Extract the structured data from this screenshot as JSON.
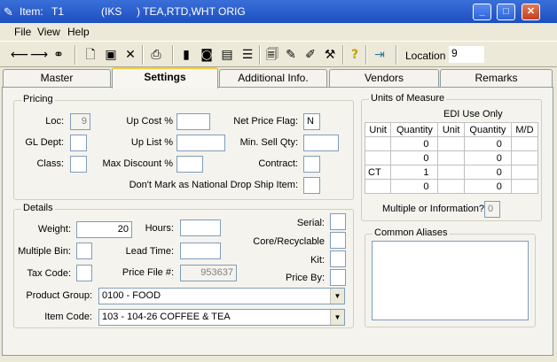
{
  "window": {
    "title_item_label": "Item:",
    "title_item_code": "T1",
    "title_item_desc": "(IKS     ) TEA,RTD,WHT ORIG",
    "minimize": "_",
    "maximize": "□",
    "close": "✕"
  },
  "menu": {
    "file": "File",
    "view": "View",
    "help": "Help"
  },
  "toolbar": {
    "location_label": "Location",
    "location_value": "9"
  },
  "tabs": [
    {
      "label": "Master"
    },
    {
      "label": "Settings"
    },
    {
      "label": "Additional Info."
    },
    {
      "label": "Vendors"
    },
    {
      "label": "Remarks"
    }
  ],
  "pricing": {
    "group_label": "Pricing",
    "loc_label": "Loc:",
    "loc_value": "9",
    "gl_dept_label": "GL Dept:",
    "gl_dept_value": "",
    "class_label": "Class:",
    "class_value": "",
    "up_cost_label": "Up Cost %",
    "up_cost_value": "",
    "up_list_label": "Up List %",
    "up_list_value": "",
    "max_discount_label": "Max Discount %",
    "max_discount_value": "",
    "net_price_flag_label": "Net Price Flag:",
    "net_price_flag_value": "N",
    "min_sell_qty_label": "Min. Sell Qty:",
    "min_sell_qty_value": "",
    "contract_label": "Contract:",
    "contract_value": "",
    "drop_ship_label": "Don't Mark as National Drop Ship Item:",
    "drop_ship_value": ""
  },
  "details": {
    "group_label": "Details",
    "weight_label": "Weight:",
    "weight_value": "20",
    "hours_label": "Hours:",
    "hours_value": "",
    "multiple_bin_label": "Multiple Bin:",
    "multiple_bin_value": "",
    "lead_time_label": "Lead Time:",
    "lead_time_value": "",
    "tax_code_label": "Tax Code:",
    "tax_code_value": "",
    "price_file_label": "Price File #:",
    "price_file_value": "953637",
    "serial_label": "Serial:",
    "serial_value": "",
    "core_label": "Core/Recyclable",
    "core_value": "",
    "kit_label": "Kit:",
    "kit_value": "",
    "price_by_label": "Price By:",
    "price_by_value": "",
    "product_group_label": "Product Group:",
    "product_group_value": "0100 - FOOD",
    "item_code_label": "Item Code:",
    "item_code_value": "103 - 104-26 COFFEE & TEA"
  },
  "uom": {
    "group_label": "Units of Measure",
    "edi_label": "EDI Use Only",
    "headers": [
      "Unit",
      "Quantity",
      "Unit",
      "Quantity",
      "M/D"
    ],
    "rows": [
      [
        "",
        "0",
        "",
        "0",
        ""
      ],
      [
        "",
        "0",
        "",
        "0",
        ""
      ],
      [
        "CT",
        "1",
        "",
        "0",
        ""
      ],
      [
        "",
        "0",
        "",
        "0",
        ""
      ]
    ],
    "multiple_label": "Multiple or Information?",
    "multiple_value": "0"
  },
  "aliases": {
    "group_label": "Common Aliases"
  }
}
